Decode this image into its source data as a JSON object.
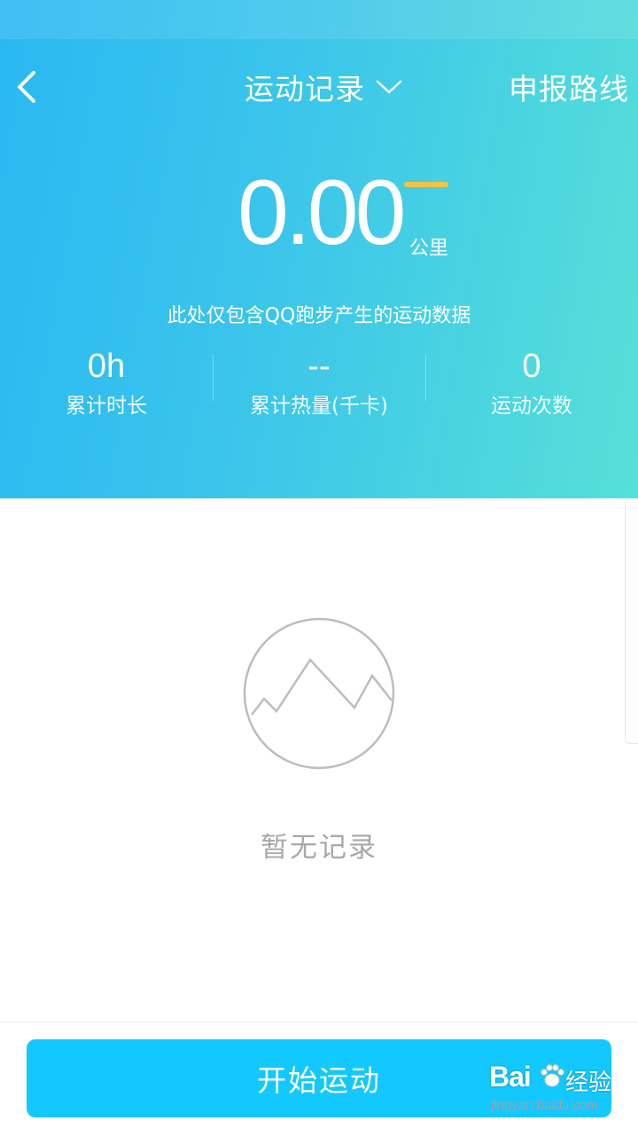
{
  "header": {
    "title": "运动记录",
    "report_label": "申报路线",
    "back_icon": "chevron-left-icon",
    "title_dropdown_icon": "chevron-down-icon"
  },
  "summary": {
    "distance": "0.00",
    "unit": "公里",
    "note": "此处仅包含QQ跑步产生的运动数据",
    "stats": [
      {
        "value": "0h",
        "label": "累计时长"
      },
      {
        "value": "--",
        "label": "累计热量(千卡)"
      },
      {
        "value": "0",
        "label": "运动次数"
      }
    ]
  },
  "empty_state": {
    "icon": "mountain-icon",
    "text": "暂无记录"
  },
  "footer": {
    "start_label": "开始运动"
  },
  "watermark": {
    "logo": "Bai",
    "name": "经验",
    "url": "jingyan.baidu.com"
  },
  "colors": {
    "gradient_start": "#2ab8f2",
    "gradient_end": "#56e0d8",
    "accent_dash": "#f5c242",
    "button": "#12c8ff"
  }
}
